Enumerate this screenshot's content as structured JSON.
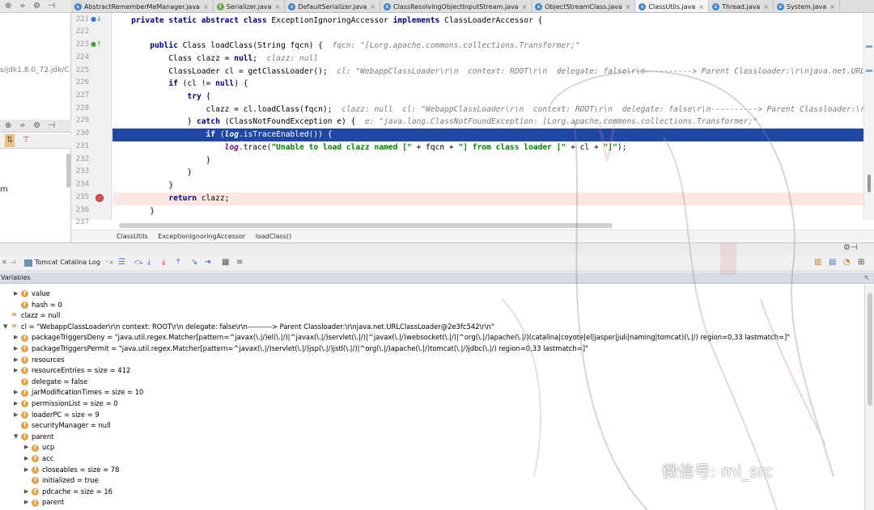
{
  "tabs": [
    {
      "label": "AbstractRememberMeManager.java",
      "kind": "c",
      "active": false
    },
    {
      "label": "Serializer.java",
      "kind": "i",
      "active": false
    },
    {
      "label": "DefaultSerializer.java",
      "kind": "c",
      "active": false
    },
    {
      "label": "ClassResolvingObjectInputStream.java",
      "kind": "c",
      "active": false
    },
    {
      "label": "ObjectStreamClass.java",
      "kind": "c",
      "active": false
    },
    {
      "label": "ClassUtils.java",
      "kind": "c",
      "active": true
    },
    {
      "label": "Thread.java",
      "kind": "c",
      "active": false
    },
    {
      "label": "System.java",
      "kind": "c",
      "active": false
    }
  ],
  "left_panel": {
    "path": "s/jdk1.8.0_72.jdk/C",
    "item": "m"
  },
  "lines": {
    "n221": "221",
    "n222": "222",
    "n223": "223",
    "n224": "224",
    "n225": "225",
    "n226": "226",
    "n227": "227",
    "n228": "228",
    "n229": "229",
    "n230": "230",
    "n231": "231",
    "n232": "232",
    "n233": "233",
    "n234": "234",
    "n235": "235",
    "n236": "236",
    "n237": "237"
  },
  "code": {
    "l221_kw": "private static abstract class",
    "l221_rest": " ExceptionIgnoringAccessor ",
    "l221_kw2": "implements",
    "l221_end": " ClassLoaderAccessor {",
    "l223_kw": "public",
    "l223_rest": " Class loadClass(String fqcn) {  ",
    "l223_hint": "fqcn: \"[Lorg.apache.commons.collections.Transformer;\"",
    "l224_a": "Class clazz = ",
    "l224_kw": "null",
    "l224_b": ";  ",
    "l224_hint": "clazz: null",
    "l225_a": "ClassLoader cl = getClassLoader();  ",
    "l225_hint": "cl: \"WebappClassLoader\\r\\n  context: ROOT\\r\\n  delegate: false\\r\\n----------> Parent Classloader:\\r\\njava.net.URLClassLoade",
    "l226_kw": "if",
    "l226_a": " (cl != ",
    "l226_kw2": "null",
    "l226_b": ") {",
    "l227_kw": "try",
    "l227_a": " {",
    "l228_a": "clazz = cl.loadClass(fqcn);  ",
    "l228_hint": "clazz: null  cl: \"WebappClassLoader\\r\\n  context: ROOT\\r\\n  delegate: false\\r\\n----------> Parent Classloader:\\r\\njava.net",
    "l229_a": "} ",
    "l229_kw": "catch",
    "l229_b": " (ClassNotFoundException e) {  ",
    "l229_hint": "e: \"java.lang.ClassNotFoundException: [Lorg.apache.commons.collections.Transformer;\"",
    "l230_kw": "if",
    "l230_a": " (",
    "l230_fld": "log",
    "l230_b": ".isTraceEnabled()) {",
    "l231_fld": "log",
    "l231_a": ".trace(",
    "l231_s1": "\"Unable to load clazz named [\"",
    "l231_b": " + fqcn + ",
    "l231_s2": "\"] from class loader [\"",
    "l231_c": " + cl + ",
    "l231_s3": "\"]\"",
    "l231_d": ");",
    "l232": "}",
    "l233": "}",
    "l234": "}",
    "l235_kw": "return",
    "l235_a": " clazz;",
    "l236": "}"
  },
  "breadcrumb": [
    "ClassUtils",
    "ExceptionIgnoringAccessor",
    "loadClass()"
  ],
  "debug": {
    "tab_label": "Tomcat Catalina Log",
    "vars_title": "Variables"
  },
  "variables": [
    {
      "indent": 1,
      "arrow": "▶",
      "icon": "f",
      "text": "value"
    },
    {
      "indent": 1,
      "arrow": "",
      "icon": "f",
      "text": "hash = 0"
    },
    {
      "indent": 0,
      "arrow": "",
      "icon": "=",
      "text": "clazz = null"
    },
    {
      "indent": 0,
      "arrow": "▼",
      "icon": "=",
      "text": "cl = \"WebappClassLoader\\r\\n  context: ROOT\\r\\n  delegate: false\\r\\n----------> Parent Classloader:\\r\\njava.net.URLClassLoader@2e3fc542\\r\\n\""
    },
    {
      "indent": 1,
      "arrow": "▶",
      "icon": "f",
      "text": "packageTriggersDeny = \"java.util.regex.Matcher[pattern=^javax(\\.|/)el(\\.|/)|^javax(\\.|/)servlet(\\.|/)|^javax(\\.|/)websocket(\\.|/)|^org(\\.|/)apache(\\.|/)(catalina|coyote|el|jasper|juli|naming|tomcat)(\\.|/) region=0,33 lastmatch=]\""
    },
    {
      "indent": 1,
      "arrow": "▶",
      "icon": "f",
      "text": "packageTriggersPermit = \"java.util.regex.Matcher[pattern=^javax(\\.|/)servlet(\\.|/)jsp(\\.|/)jstl(\\.|/)|^org(\\.|/)apache(\\.|/)tomcat(\\.|/)jdbc(\\.|/) region=0,33 lastmatch=]\""
    },
    {
      "indent": 1,
      "arrow": "▶",
      "icon": "f",
      "text": "resources"
    },
    {
      "indent": 1,
      "arrow": "▶",
      "icon": "f",
      "text": "resourceEntries =  size = 412"
    },
    {
      "indent": 1,
      "arrow": "",
      "icon": "f",
      "text": "delegate = false"
    },
    {
      "indent": 1,
      "arrow": "▶",
      "icon": "f",
      "text": "jarModificationTimes =  size = 10"
    },
    {
      "indent": 1,
      "arrow": "▶",
      "icon": "f",
      "text": "permissionList =  size = 0"
    },
    {
      "indent": 1,
      "arrow": "▶",
      "icon": "f",
      "text": "loaderPC =  size = 9"
    },
    {
      "indent": 1,
      "arrow": "",
      "icon": "f",
      "text": "securityManager = null"
    },
    {
      "indent": 1,
      "arrow": "▼",
      "icon": "f",
      "text": "parent"
    },
    {
      "indent": 2,
      "arrow": "▶",
      "icon": "f",
      "text": "ucp"
    },
    {
      "indent": 2,
      "arrow": "▶",
      "icon": "f",
      "text": "acc"
    },
    {
      "indent": 2,
      "arrow": "▶",
      "icon": "f",
      "text": "closeables =  size = 78"
    },
    {
      "indent": 2,
      "arrow": "",
      "icon": "f",
      "text": "initialized = true"
    },
    {
      "indent": 2,
      "arrow": "▶",
      "icon": "f",
      "text": "pdcache =  size = 16"
    },
    {
      "indent": 2,
      "arrow": "▶",
      "icon": "f",
      "text": "parent"
    }
  ],
  "watermark": "微信号: ml_src"
}
